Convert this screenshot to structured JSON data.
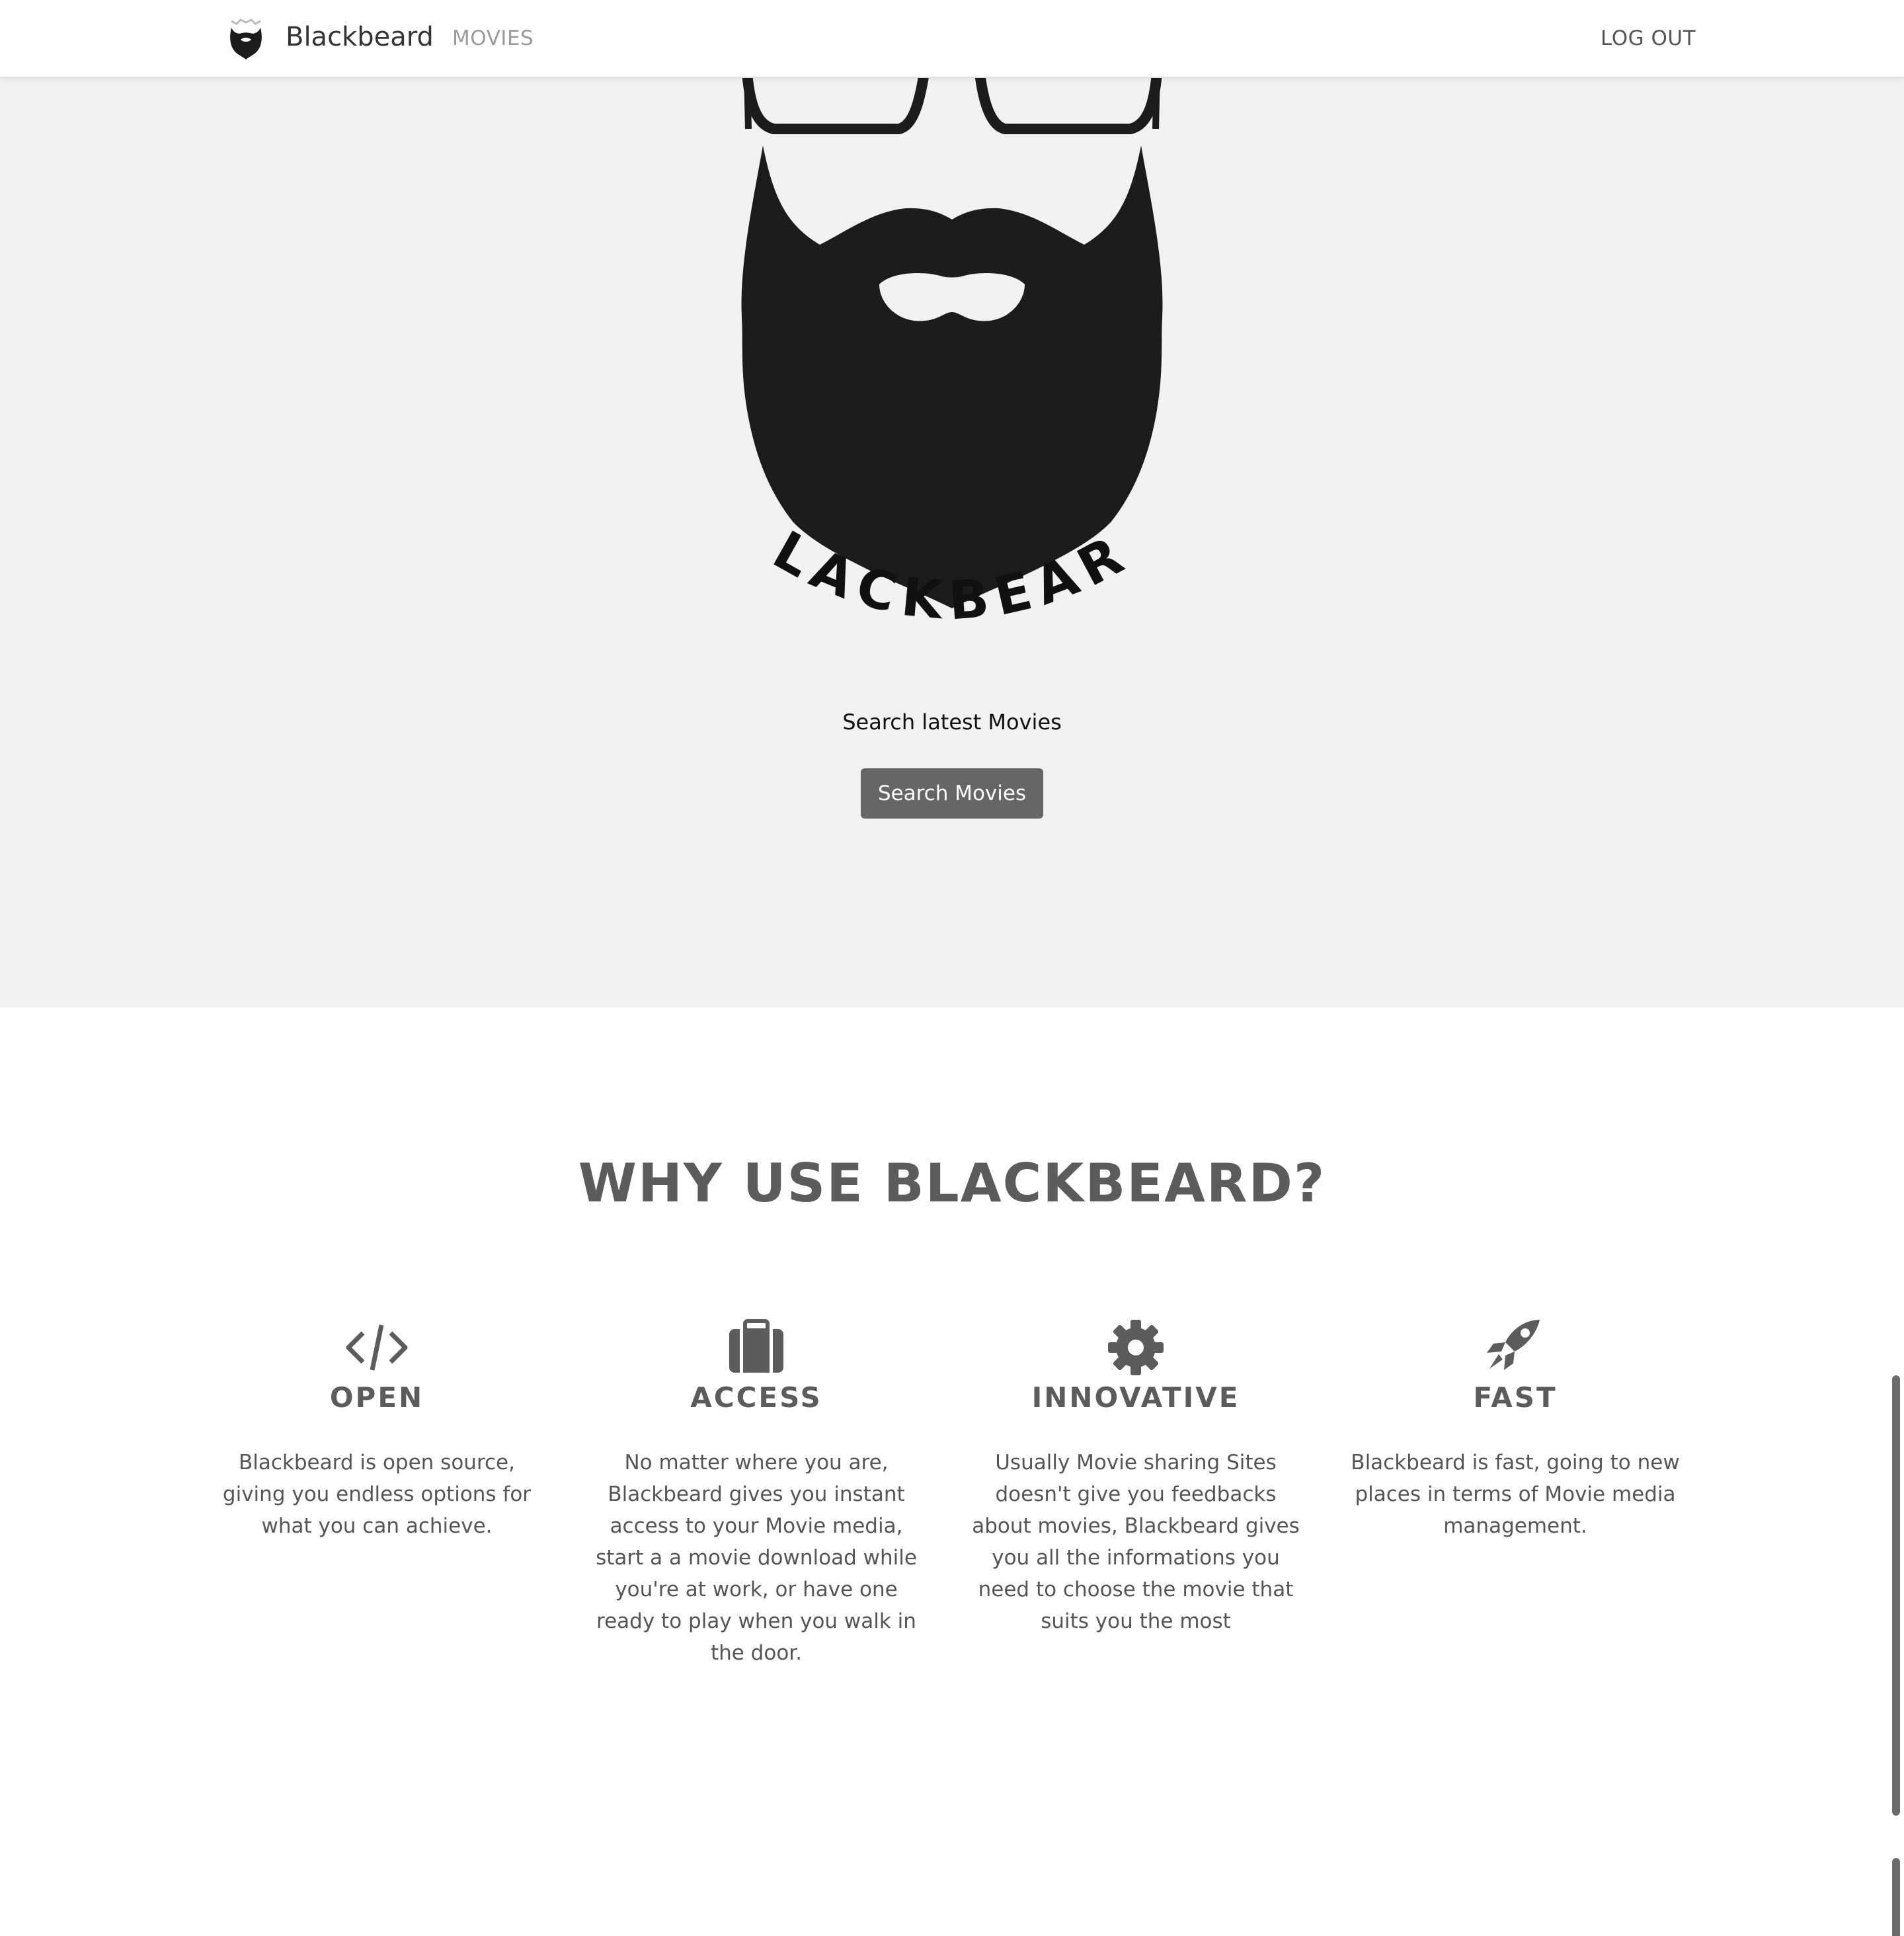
{
  "nav": {
    "brand": "Blackbeard",
    "movies_link": "MOVIES",
    "logout_link": "LOG OUT"
  },
  "hero": {
    "logo_text": "BLACKBEARD",
    "tagline": "Search latest Movies",
    "button_label": "Search Movies"
  },
  "why": {
    "title": "WHY USE BLACKBEARD?",
    "features": [
      {
        "icon": "code-icon",
        "title": "OPEN",
        "text": "Blackbeard is open source, giving you endless options for what you can achieve."
      },
      {
        "icon": "briefcase-icon",
        "title": "ACCESS",
        "text": "No matter where you are, Blackbeard gives you instant access to your Movie media, start a a movie download while you're at work, or have one ready to play when you walk in the door."
      },
      {
        "icon": "gear-icon",
        "title": "INNOVATIVE",
        "text": "Usually Movie sharing Sites doesn't give you feedbacks about movies, Blackbeard gives you all the informations you need to choose the movie that suits you the most"
      },
      {
        "icon": "rocket-icon",
        "title": "FAST",
        "text": "Blackbeard is fast, going to new places in terms of Movie media management."
      }
    ]
  },
  "colors": {
    "hero_background": "#f1f1f1",
    "button_background": "#666666",
    "heading_text": "#5c5c5c",
    "beard": "#1c1c1c"
  }
}
